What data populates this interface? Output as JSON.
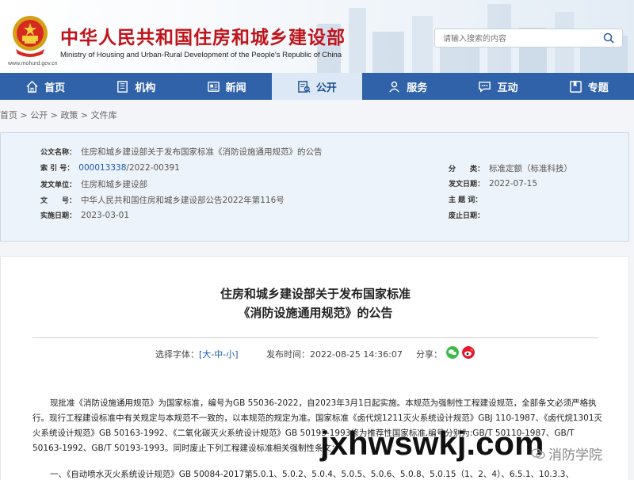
{
  "header": {
    "title": "中华人民共和国住房和城乡建设部",
    "subtitle": "Ministry of Housing and Urban-Rural Development of the People's Republic of China",
    "domain": "www.mohurd.gov.cn",
    "search_placeholder": "请输入搜索的内容"
  },
  "nav": [
    {
      "label": "首页",
      "icon": "home-icon"
    },
    {
      "label": "机构",
      "icon": "building-icon"
    },
    {
      "label": "新闻",
      "icon": "newspaper-icon"
    },
    {
      "label": "公开",
      "icon": "public-icon",
      "active": true
    },
    {
      "label": "服务",
      "icon": "service-icon"
    },
    {
      "label": "互动",
      "icon": "chat-icon"
    },
    {
      "label": "专题",
      "icon": "bookmark-icon"
    }
  ],
  "breadcrumb": [
    "首页",
    "公开",
    "政策",
    "文件库"
  ],
  "breadcrumb_sep": " > ",
  "meta": {
    "name_label": "公文名称：",
    "name_value": "住房和城乡建设部关于发布国家标准《消防设施通用规范》的公告",
    "index_label": "索 引 号：",
    "index_value_a": "000013338",
    "index_value_b": "/2022-00391",
    "issuer_label": "发文单位：",
    "issuer_value": "住房和城乡建设部",
    "doc_label": "文　　号：",
    "doc_value": "中华人民共和国住房和城乡建设部公告2022年第116号",
    "impl_label": "实施日期：",
    "impl_value": "2023-03-01",
    "class_label": "分　　类：",
    "class_value": "标准定额（标准科技）",
    "date_label": "发文日期：",
    "date_value": "2022-07-15",
    "topic_label": "主 题 词：",
    "topic_value": "",
    "repeal_label": "废止日期：",
    "repeal_value": ""
  },
  "article": {
    "title_line1": "住房和城乡建设部关于发布国家标准",
    "title_line2": "《消防设施通用规范》的公告",
    "font_label": "选择字体：",
    "font_open": "[",
    "font_large": "大",
    "font_mid": "中",
    "font_small": "小",
    "font_close": "]",
    "font_sep": "-",
    "pub_label": "发布时间：",
    "pub_value": "2022-08-25 14:36:07",
    "share_label": "分享：",
    "para1": "现批准《消防设施通用规范》为国家标准，编号为GB 55036-2022，自2023年3月1日起实施。本规范为强制性工程建设规范，全部条文必须严格执行。现行工程建设标准中有关规定与本规范不一致的，以本规范的规定为准。国家标准《卤代烷1211灭火系统设计规范》GBJ 110-1987、《卤代烷1301灭火系统设计规范》GB 50163-1992、《二氧化碳灭火系统设计规范》GB 50193-1993修为推荐性国家标准,编号分别为:GB/T 50110-1987、GB/T 50163-1992、GB/T 50193-1993。同时废止下列工程建设标准相关强制性条文：",
    "para2": "一、《自动喷水灭火系统设计规范》GB 50084-2017第5.0.1、5.0.2、5.0.4、5.0.5、5.0.6、5.0.8、5.0.15（1、2、4）、6.5.1、10.3.3、"
  },
  "watermark": {
    "text": "jxhwswkj.com",
    "text2": "消防学院"
  },
  "colors": {
    "brand_red": "#c0141b",
    "nav_blue": "#2f62a8",
    "link_blue": "#1a57b0"
  }
}
